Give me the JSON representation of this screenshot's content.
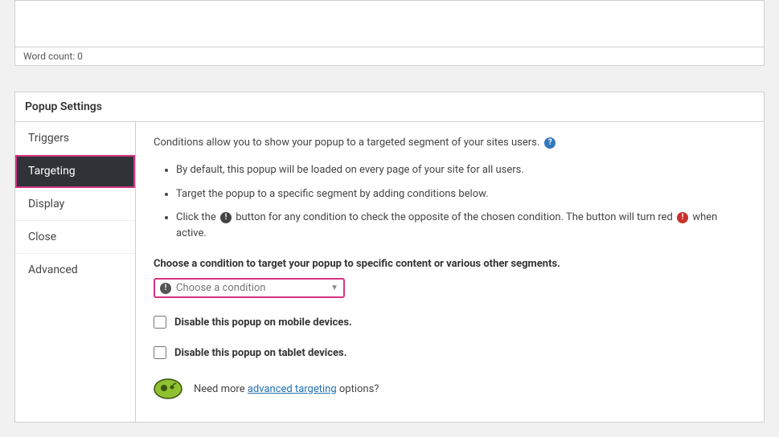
{
  "wordcount_bar": {
    "label": "Word count: 0"
  },
  "panel": {
    "title": "Popup Settings",
    "tabs": {
      "triggers": "Triggers",
      "targeting": "Targeting",
      "display": "Display",
      "close": "Close",
      "advanced": "Advanced",
      "active": "targeting"
    }
  },
  "content": {
    "intro": "Conditions allow you to show your popup to a targeted segment of your sites users.",
    "bullets": {
      "b1": "By default, this popup will be loaded on every page of your site for all users.",
      "b2": "Target the popup to a specific segment by adding conditions below.",
      "b3_pre": "Click the",
      "b3_mid": "button for any condition to check the opposite of the chosen condition. The button will turn red",
      "b3_post": "when active."
    },
    "choose_label": "Choose a condition to target your popup to specific content or various other segments.",
    "condition_select": {
      "placeholder": "Choose a condition"
    },
    "disable_mobile_label": "Disable this popup on mobile devices.",
    "disable_tablet_label": "Disable this popup on tablet devices.",
    "footer_pre": "Need more ",
    "footer_link": "advanced targeting",
    "footer_post": " options?"
  }
}
